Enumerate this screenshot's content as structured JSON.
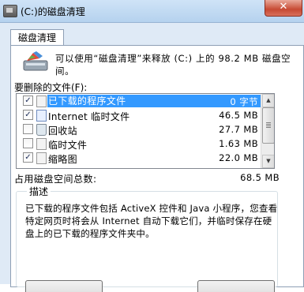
{
  "window": {
    "title": "(C:)的磁盘清理",
    "close_label": "✕"
  },
  "tab": {
    "label": "磁盘清理"
  },
  "summary": {
    "text": "可以使用“磁盘清理”来释放 (C:) 上的 98.2 MB 磁盘空间。"
  },
  "list": {
    "label": "要删除的文件(F):",
    "items": [
      {
        "checked": true,
        "name": "已下载的程序文件",
        "size": "0 字节",
        "selected": true
      },
      {
        "checked": true,
        "name": "Internet 临时文件",
        "size": "46.5 MB",
        "selected": false
      },
      {
        "checked": false,
        "name": "回收站",
        "size": "27.7 MB",
        "selected": false
      },
      {
        "checked": false,
        "name": "临时文件",
        "size": "1.63 MB",
        "selected": false
      },
      {
        "checked": true,
        "name": "缩略图",
        "size": "22.0 MB",
        "selected": false
      }
    ]
  },
  "total": {
    "label": "占用磁盘空间总数:",
    "value": "68.5 MB"
  },
  "description": {
    "title": "描述",
    "text": "已下载的程序文件包括 ActiveX 控件和 Java 小程序，您查看特定网页时将会从 Internet 自动下载它们，并临时保存在硬盘上的已下载的程序文件夹中。"
  },
  "colors": {
    "selection": "#3399ff",
    "frame": "#dfeaf6",
    "close": "#c74a33"
  }
}
